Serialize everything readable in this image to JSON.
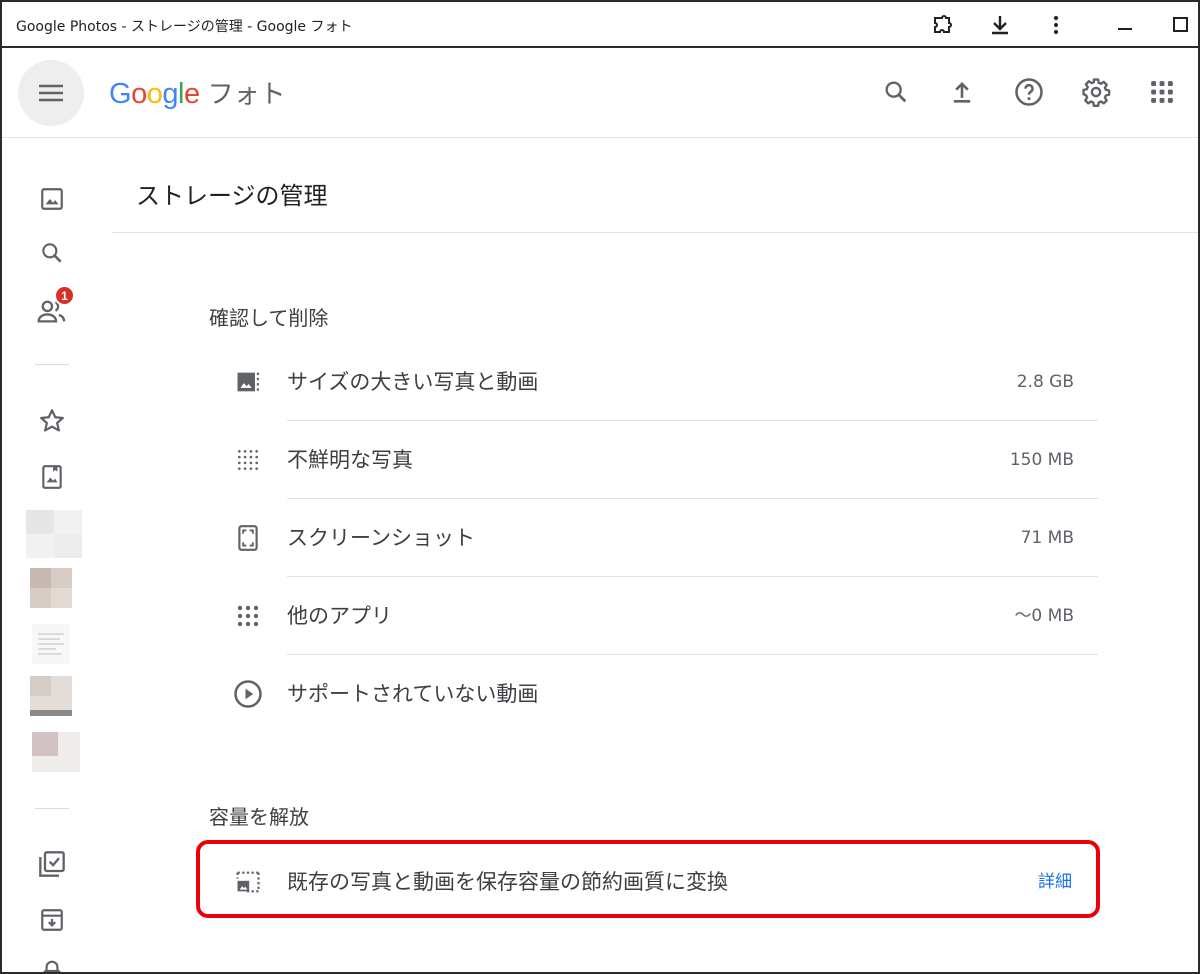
{
  "window": {
    "title": "Google Photos - ストレージの管理 - Google フォト",
    "buttons": [
      "extension-icon",
      "download-icon",
      "more-vert-icon",
      "minimize-icon",
      "maximize-icon"
    ]
  },
  "header": {
    "logo_letters": [
      {
        "ch": "G",
        "color": "#4285F4"
      },
      {
        "ch": "o",
        "color": "#EA4335"
      },
      {
        "ch": "o",
        "color": "#FBBC05"
      },
      {
        "ch": "g",
        "color": "#4285F4"
      },
      {
        "ch": "l",
        "color": "#34A853"
      },
      {
        "ch": "e",
        "color": "#EA4335"
      }
    ],
    "logo_suffix": "フォト",
    "icons": [
      "search-icon",
      "upload-icon",
      "help-icon",
      "settings-icon",
      "apps-icon"
    ]
  },
  "sidebar": {
    "items": [
      {
        "icon": "photos-icon"
      },
      {
        "icon": "search-icon"
      },
      {
        "icon": "sharing-icon",
        "badge": "1"
      },
      {
        "icon": "star-icon"
      },
      {
        "icon": "albums-icon"
      },
      {
        "icon": "utilities-icon"
      },
      {
        "icon": "archive-icon"
      },
      {
        "icon": "lock-icon"
      }
    ]
  },
  "main": {
    "title": "ストレージの管理",
    "review_section": {
      "heading": "確認して削除",
      "rows": [
        {
          "icon": "large-photos-icon",
          "label": "サイズの大きい写真と動画",
          "value": "2.8 GB"
        },
        {
          "icon": "blurry-icon",
          "label": "不鮮明な写真",
          "value": "150 MB"
        },
        {
          "icon": "screenshot-icon",
          "label": "スクリーンショット",
          "value": "71 MB"
        },
        {
          "icon": "other-apps-icon",
          "label": "他のアプリ",
          "value": "～0 MB"
        },
        {
          "icon": "unsupported-video-icon",
          "label": "サポートされていない動画",
          "value": ""
        }
      ]
    },
    "free_up_section": {
      "heading": "容量を解放",
      "row": {
        "icon": "compress-icon",
        "label": "既存の写真と動画を保存容量の節約画質に変換",
        "link": "詳細"
      }
    }
  },
  "colors": {
    "highlight": "#e8000b",
    "link": "#1a73e8",
    "badge": "#d93025"
  }
}
